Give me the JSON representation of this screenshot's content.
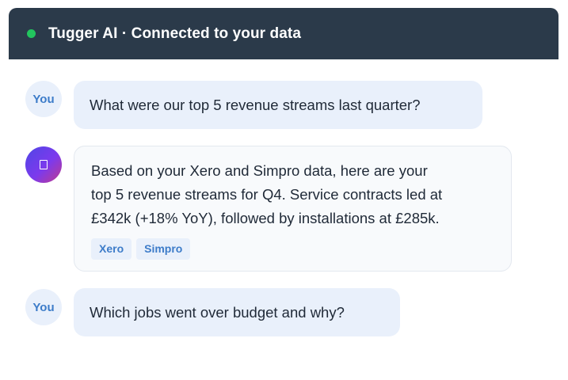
{
  "header": {
    "title": "Tugger AI · Connected to your data"
  },
  "messages": [
    {
      "role": "user",
      "avatar_label": "You",
      "text": "What were our top 5 revenue streams last quarter?"
    },
    {
      "role": "assistant",
      "avatar_icon": "ai-assistant-icon",
      "lines": [
        "Based on your Xero and Simpro data, here are your",
        "top 5 revenue streams for Q4. Service contracts led at",
        "£342k (+18% YoY), followed by installations at £285k."
      ],
      "sources": [
        "Xero",
        "Simpro"
      ]
    },
    {
      "role": "user",
      "avatar_label": "You",
      "text": "Which jobs went over budget and why?"
    }
  ],
  "colors": {
    "header_bg": "#2b3a4a",
    "status_dot": "#22c55e",
    "user_bubble": "#e9f0fb",
    "accent": "#3d7cc9"
  }
}
